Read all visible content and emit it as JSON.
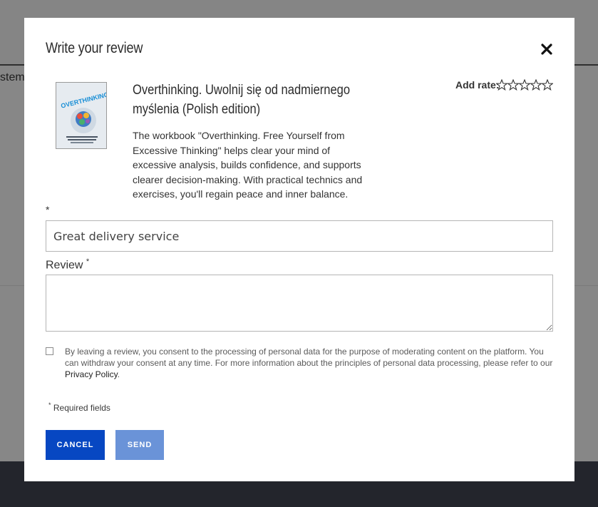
{
  "background": {
    "partial_text": "stem"
  },
  "modal": {
    "title": "Write your review",
    "close_icon": "close-icon"
  },
  "product": {
    "name": "Overthinking. Uwolnij się od nadmiernego myślenia (Polish edition)",
    "description": "The workbook \"Overthinking. Free Yourself from Excessive Thinking\" helps clear your mind of excessive analysis, builds confidence, and supports clearer decision-making. With practical technics and exercises, you'll regain peace and inner balance.",
    "cover": {
      "brand": "OVER",
      "brand_accent": "THINKING",
      "brand_color": "#1a8fd6"
    }
  },
  "rating": {
    "label": "Add rate:",
    "max_stars": 5,
    "value": 0,
    "icon": "star-outline-icon"
  },
  "form": {
    "title_required_marker": "*",
    "title_value": "Great delivery service",
    "review_label": "Review",
    "review_required_marker": "*",
    "review_value": "",
    "consent": {
      "checked": false,
      "text_before": "By leaving a review, you consent to the processing of personal data for the purpose of moderating content on the platform. You can withdraw your consent at any time. For more information about the principles of personal data processing, please refer to our ",
      "link_text": "Privacy Policy",
      "text_after": "."
    },
    "required_marker": "*",
    "required_note": "Required fields"
  },
  "buttons": {
    "cancel_label": "CANCEL",
    "send_label": "SEND",
    "cancel_color": "#0747c2",
    "send_color": "#6a93d8"
  }
}
